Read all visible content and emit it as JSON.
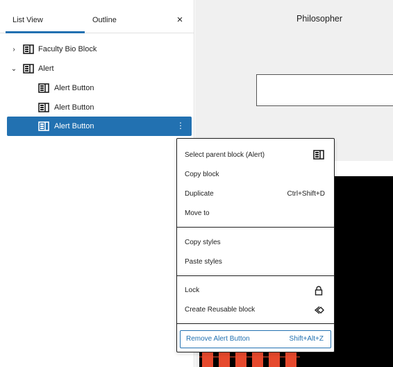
{
  "tabs": {
    "list_view": "List View",
    "outline": "Outline",
    "close": "×"
  },
  "tree": [
    {
      "label": "Faculty Bio Block",
      "chevron": "›",
      "icon": "block-icon"
    },
    {
      "label": "Alert",
      "chevron": "⌄",
      "icon": "block-icon"
    },
    {
      "label": "Alert Button",
      "icon": "block-icon"
    },
    {
      "label": "Alert Button",
      "icon": "block-icon"
    },
    {
      "label": "Alert Button",
      "icon": "block-icon",
      "selected": true,
      "more": "⋮"
    }
  ],
  "canvas": {
    "title": "Philosopher"
  },
  "menu": {
    "select_parent": "Select parent block (Alert)",
    "copy_block": "Copy block",
    "duplicate": "Duplicate",
    "duplicate_shortcut": "Ctrl+Shift+D",
    "move_to": "Move to",
    "copy_styles": "Copy styles",
    "paste_styles": "Paste styles",
    "lock": "Lock",
    "create_reusable": "Create Reusable block",
    "remove": "Remove Alert Button",
    "remove_shortcut": "Shift+Alt+Z"
  },
  "colors": {
    "accent": "#2271b1",
    "canvas_bg": "#f0f0f0",
    "orange": "#e6492d"
  }
}
